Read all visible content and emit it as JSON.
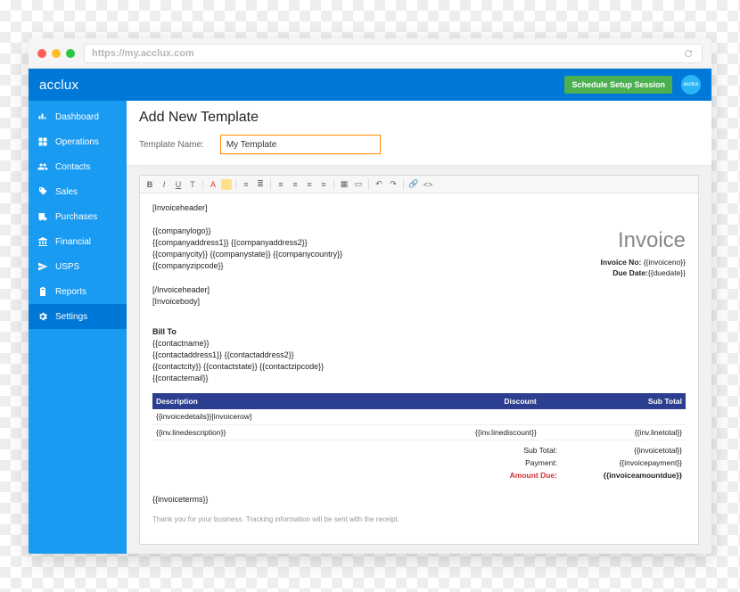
{
  "browser": {
    "url": "https://my.acclux.com"
  },
  "header": {
    "brand": "acclux",
    "cta": "Schedule Setup Session",
    "avatar_label": "acclux"
  },
  "sidebar": {
    "items": [
      {
        "label": "Dashboard"
      },
      {
        "label": "Operations"
      },
      {
        "label": "Contacts"
      },
      {
        "label": "Sales"
      },
      {
        "label": "Purchases"
      },
      {
        "label": "Financial"
      },
      {
        "label": "USPS"
      },
      {
        "label": "Reports"
      },
      {
        "label": "Settings"
      }
    ]
  },
  "page": {
    "title": "Add New Template",
    "field_label": "Template Name:",
    "field_value": "My Template"
  },
  "template": {
    "section_open": "[Invoiceheader]",
    "company": {
      "logo": "{{companylogo}}",
      "addr1": "{{companyaddress1}} {{companyaddress2}}",
      "city": "{{companycity}} {{companystate}} {{companycountry}}",
      "zip": "{{companyzipcode}}"
    },
    "invoice_title": "Invoice",
    "meta": {
      "no_label": "Invoice No:",
      "no_value": "{{invoiceno}}",
      "due_label": "Due Date:",
      "due_value": "{{duedate}}"
    },
    "section_close": "[/Invoiceheader]",
    "body_open": "[Invoicebody]",
    "billto": {
      "heading": "Bill To",
      "name": "{{contactname}}",
      "addr": "{{contactaddress1}} {{contactaddress2}}",
      "city": "{{contactcity}} {{contactstate}} {{contactzipcode}}",
      "email": "{{contactemail}}"
    },
    "table": {
      "headers": {
        "desc": "Description",
        "discount": "Discount",
        "subtotal": "Sub Total"
      },
      "row_open": "{{invoicedetails}}[invoicerow]",
      "desc": "{{inv.linedescription}}",
      "discount": "{{inv.linediscount}}",
      "linetotal": "{{inv.linetotal}}"
    },
    "totals": {
      "subtotal_label": "Sub Total:",
      "subtotal_value": "{{invoicetotal}}",
      "payment_label": "Payment:",
      "payment_value": "{{invoicepayment}}",
      "amountdue_label": "Amount Due:",
      "amountdue_value": "{{invoiceamountdue}}"
    },
    "terms": "{{invoiceterms}}",
    "thanks": "Thank you for your business. Tracking information will be sent with the receipt."
  }
}
